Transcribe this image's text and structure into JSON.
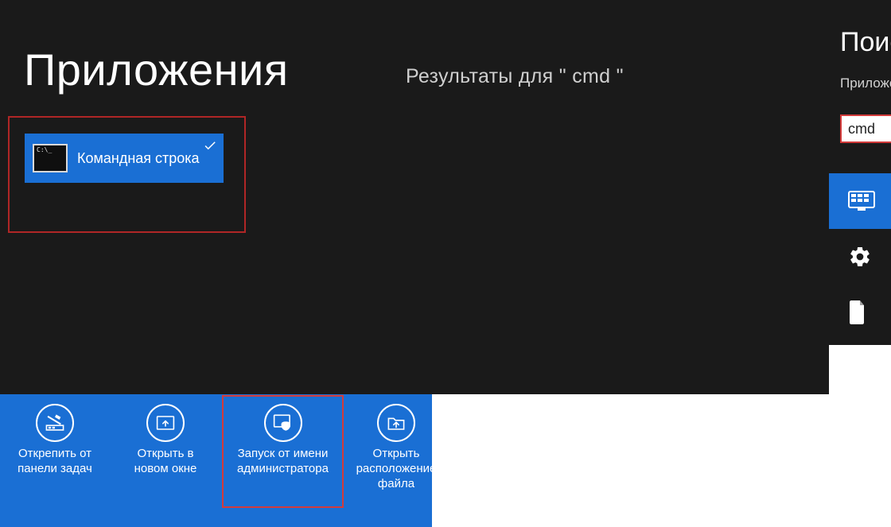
{
  "main": {
    "title": "Приложения",
    "results_prefix": "Результаты для",
    "results_query": "cmd",
    "tile": {
      "label": "Командная строка"
    }
  },
  "sidebar": {
    "title": "Поиск",
    "subtitle": "Приложения",
    "search_value": "cmd",
    "scopes": [
      {
        "id": "apps",
        "icon": "apps-icon",
        "active": true
      },
      {
        "id": "settings",
        "icon": "gear-icon",
        "active": false
      },
      {
        "id": "files",
        "icon": "file-icon",
        "active": false
      }
    ]
  },
  "appbar": {
    "items": [
      {
        "id": "unpin",
        "label": "Открепить от\nпанели задач"
      },
      {
        "id": "newwin",
        "label": "Открыть в\nновом окне"
      },
      {
        "id": "runas",
        "label": "Запуск от имени\nадминистратора"
      },
      {
        "id": "openloc",
        "label": "Открыть\nрасположение\nфайла"
      }
    ]
  },
  "colors": {
    "bg_dark": "#1a1a1a",
    "accent_blue": "#1a6fd4",
    "annotation_red": "#d23a3a"
  }
}
